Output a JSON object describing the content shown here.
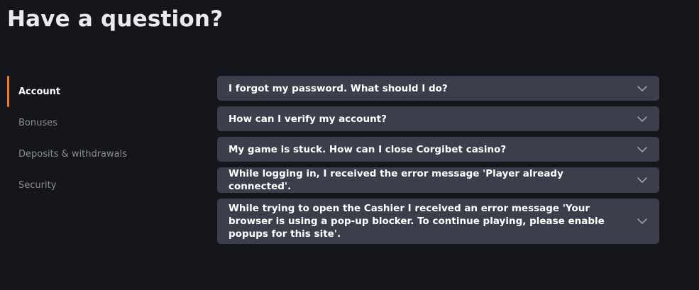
{
  "page": {
    "title": "Have a question?"
  },
  "sidebar": {
    "items": [
      {
        "label": "Account",
        "active": true
      },
      {
        "label": "Bonuses",
        "active": false
      },
      {
        "label": "Deposits & withdrawals",
        "active": false
      },
      {
        "label": "Security",
        "active": false
      }
    ]
  },
  "faq": {
    "items": [
      {
        "question": "I forgot my password. What should I do?",
        "icon": "chevron-down-icon"
      },
      {
        "question": "How can I verify my account?",
        "icon": "chevron-down-icon"
      },
      {
        "question": "My game is stuck. How can I close Corgibet casino?",
        "icon": "chevron-down-icon"
      },
      {
        "question": "While logging in, I received the error message 'Player already connected'.",
        "icon": "chevron-down-icon"
      },
      {
        "question": "While trying to open the Cashier I received an error message 'Your browser is using a pop-up blocker. To continue playing, please enable popups for this site'.",
        "icon": "chevron-down-icon"
      }
    ]
  },
  "colors": {
    "background": "#15161b",
    "card": "#3b3f4b",
    "accent": "#f07d1e",
    "muted_text": "#8a8d96"
  }
}
